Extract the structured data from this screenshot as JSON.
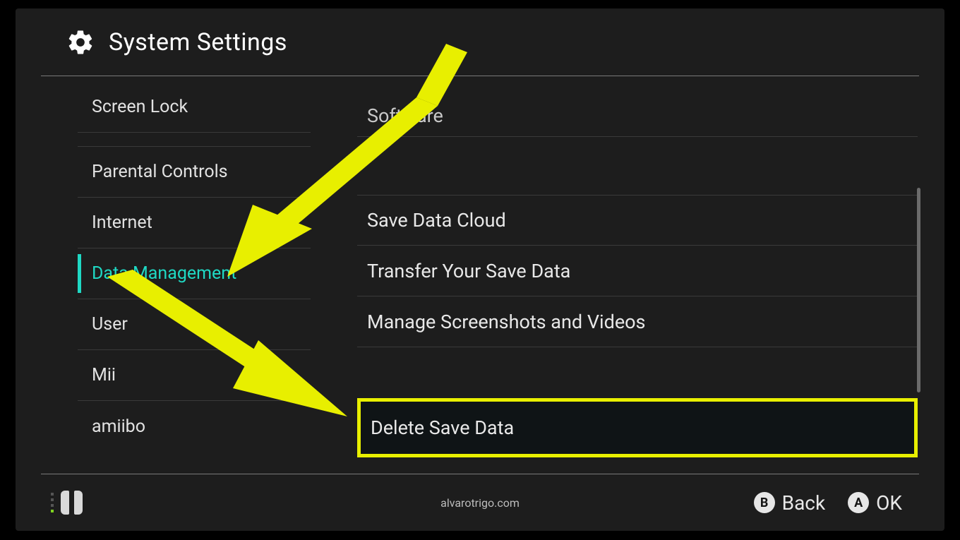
{
  "header": {
    "title": "System Settings"
  },
  "sidebar": {
    "items": [
      {
        "label": "Screen Lock",
        "selected": false
      },
      {
        "label": "Parental Controls",
        "selected": false
      },
      {
        "label": "Internet",
        "selected": false
      },
      {
        "label": "Data Management",
        "selected": true
      },
      {
        "label": "User",
        "selected": false
      },
      {
        "label": "Mii",
        "selected": false
      },
      {
        "label": "amiibo",
        "selected": false
      }
    ]
  },
  "main": {
    "topcut_label": "Software",
    "items": [
      {
        "label": "Save Data Cloud"
      },
      {
        "label": "Transfer Your Save Data"
      },
      {
        "label": "Manage Screenshots and Videos"
      }
    ],
    "highlighted": {
      "label": "Delete Save Data"
    }
  },
  "footer": {
    "watermark": "alvarotrigo.com",
    "back": {
      "letter": "B",
      "label": "Back"
    },
    "ok": {
      "letter": "A",
      "label": "OK"
    }
  },
  "annotation": {
    "color": "#e8ef00"
  }
}
